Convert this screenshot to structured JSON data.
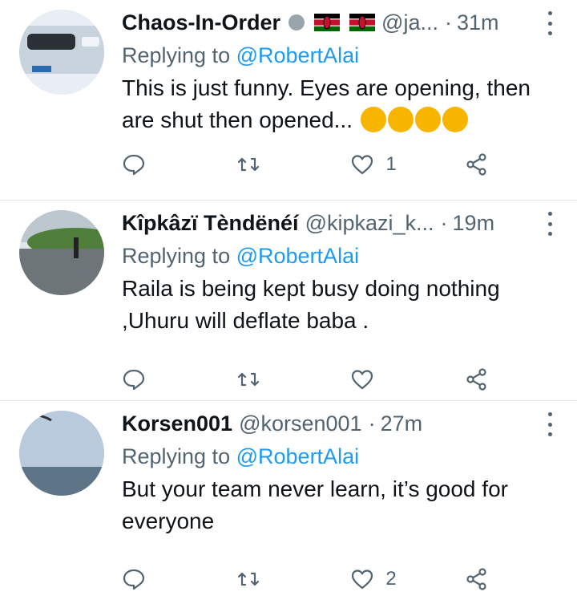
{
  "colors": {
    "accent": "#1d9bf0",
    "muted": "#536471",
    "text": "#0f1419"
  },
  "tweets": [
    {
      "name": "Chaos-In-Order",
      "handle": "@ja...",
      "time": "31m",
      "reply_prefix": "Replying to",
      "reply_to": "@RobertAlai",
      "text": "This is just funny. Eyes are opening, then are shut then opened...",
      "likes": "1",
      "has_flags": true,
      "emoji_count": 4
    },
    {
      "name": "Kîpkâzï Tèndënéí",
      "handle": "@kipkazi_k...",
      "time": "19m",
      "reply_prefix": "Replying to",
      "reply_to": "@RobertAlai",
      "text": "Raila is being kept busy doing nothing ,Uhuru will deflate baba .",
      "likes": ""
    },
    {
      "name": "Korsen001",
      "handle": "@korsen001",
      "time": "27m",
      "reply_prefix": "Replying to",
      "reply_to": "@RobertAlai",
      "text": "But your team never learn, it’s good for everyone",
      "likes": "2"
    }
  ],
  "separator": "·",
  "icons": [
    "reply-icon",
    "retweet-icon",
    "like-icon",
    "share-icon",
    "more-icon"
  ]
}
